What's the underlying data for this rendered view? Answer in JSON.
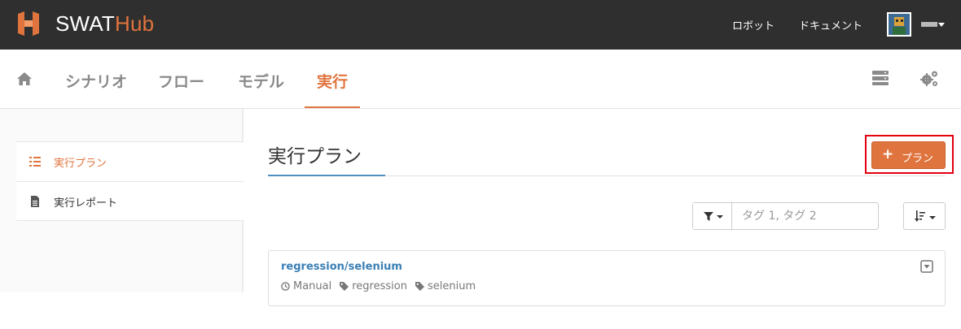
{
  "header": {
    "brand_main": "SWAT",
    "brand_accent": "Hub",
    "links": [
      {
        "label": "ロボット"
      },
      {
        "label": "ドキュメント"
      }
    ]
  },
  "nav": {
    "items": [
      {
        "label": "シナリオ"
      },
      {
        "label": "フロー"
      },
      {
        "label": "モデル"
      },
      {
        "label": "実行"
      }
    ],
    "active": "実行"
  },
  "sidebar": {
    "items": [
      {
        "label": "実行プラン",
        "icon": "list-icon",
        "active": true
      },
      {
        "label": "実行レポート",
        "icon": "file-icon",
        "active": false
      }
    ]
  },
  "main": {
    "title": "実行プラン",
    "add_button": {
      "label": "プラン",
      "icon": "plus-icon"
    },
    "filter": {
      "placeholder": "タグ 1, タグ 2",
      "value": ""
    },
    "plans": [
      {
        "name": "regression/selenium",
        "mode": "Manual",
        "tags": [
          "regression",
          "selenium"
        ]
      }
    ]
  },
  "colors": {
    "accent": "#e0743e",
    "topbar": "#2f2f2f",
    "link": "#3a7fb5",
    "highlight": "#e3000f"
  }
}
